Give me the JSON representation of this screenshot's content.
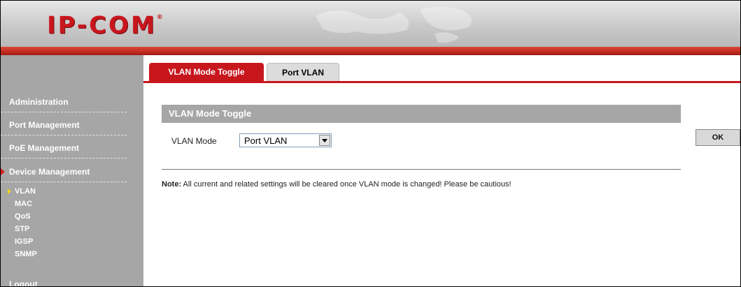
{
  "header": {
    "logo_text": "IP-COM",
    "logo_mark": "®",
    "brand_color": "#c8161d"
  },
  "sidebar": {
    "items": [
      {
        "label": "Administration"
      },
      {
        "label": "Port Management"
      },
      {
        "label": "PoE Management"
      },
      {
        "label": "Device Management",
        "active": true
      }
    ],
    "sub_items": [
      {
        "label": "VLAN",
        "active": true
      },
      {
        "label": "MAC"
      },
      {
        "label": "QoS"
      },
      {
        "label": "STP"
      },
      {
        "label": "IGSP"
      },
      {
        "label": "SNMP"
      }
    ],
    "logout_label": "Logout"
  },
  "tabs": [
    {
      "label": "VLAN Mode Toggle",
      "active": true
    },
    {
      "label": "Port VLAN",
      "active": false
    }
  ],
  "main": {
    "section_title": "VLAN Mode Toggle",
    "mode_label": "VLAN Mode",
    "mode_value": "Port VLAN",
    "note_label": "Note:",
    "note_text": " All current and related settings will be cleared once VLAN mode is changed! Please be cautious!",
    "ok_label": "OK"
  }
}
